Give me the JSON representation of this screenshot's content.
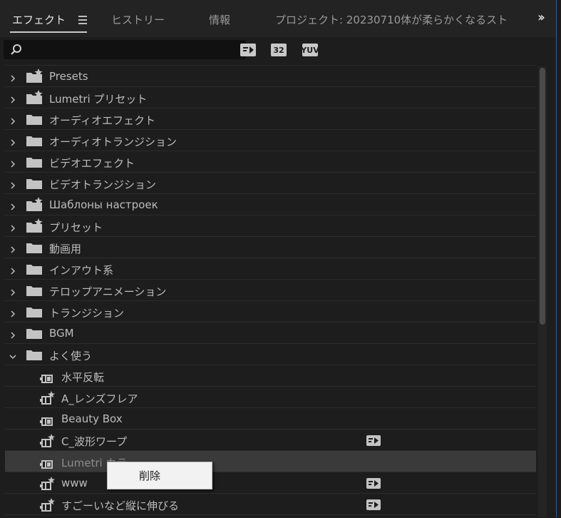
{
  "tabs": [
    {
      "label": "エフェクト",
      "active": true
    },
    {
      "label": "ヒストリー"
    },
    {
      "label": "情報"
    },
    {
      "label": "プロジェクト:  20230710体が柔らかくなるスト"
    }
  ],
  "more_tabs_icon": "double-chevron-right-icon",
  "search": {
    "placeholder": "",
    "icon": "search-icon"
  },
  "toolbar": {
    "accelerated_icon": "accelerated-effects-icon",
    "bit32_label": "32",
    "yuv_label": "YUV"
  },
  "tree": [
    {
      "label": "Presets",
      "type": "preset-folder",
      "expanded": false
    },
    {
      "label": "Lumetri プリセット",
      "type": "preset-folder",
      "expanded": false
    },
    {
      "label": "オーディオエフェクト",
      "type": "folder",
      "expanded": false
    },
    {
      "label": "オーディオトランジション",
      "type": "folder",
      "expanded": false
    },
    {
      "label": "ビデオエフェクト",
      "type": "folder",
      "expanded": false
    },
    {
      "label": "ビデオトランジション",
      "type": "folder",
      "expanded": false
    },
    {
      "label": "Шаблоны настроек",
      "type": "preset-folder",
      "expanded": false
    },
    {
      "label": "プリセット",
      "type": "preset-folder",
      "expanded": false
    },
    {
      "label": "動画用",
      "type": "folder",
      "expanded": false
    },
    {
      "label": "インアウト系",
      "type": "folder",
      "expanded": false
    },
    {
      "label": "テロップアニメーション",
      "type": "folder",
      "expanded": false
    },
    {
      "label": "トランジション",
      "type": "folder",
      "expanded": false
    },
    {
      "label": "BGM",
      "type": "folder",
      "expanded": false
    },
    {
      "label": "よく使う",
      "type": "folder",
      "expanded": true
    },
    {
      "label": "水平反転",
      "type": "effect",
      "child": true
    },
    {
      "label": "A_レンズフレア",
      "type": "preset-effect",
      "child": true
    },
    {
      "label": "Beauty Box",
      "type": "effect",
      "child": true
    },
    {
      "label": "C_波形ワープ",
      "type": "preset-effect",
      "child": true,
      "accelerated": true
    },
    {
      "label": "Lumetri カラー",
      "type": "effect",
      "child": true,
      "selected": true
    },
    {
      "label": "www",
      "type": "preset-effect",
      "child": true,
      "accelerated": true
    },
    {
      "label": "すごーいなど縦に伸びる",
      "type": "preset-effect",
      "child": true,
      "accelerated": true
    }
  ],
  "context_menu": {
    "items": [
      {
        "label": "削除"
      }
    ]
  }
}
